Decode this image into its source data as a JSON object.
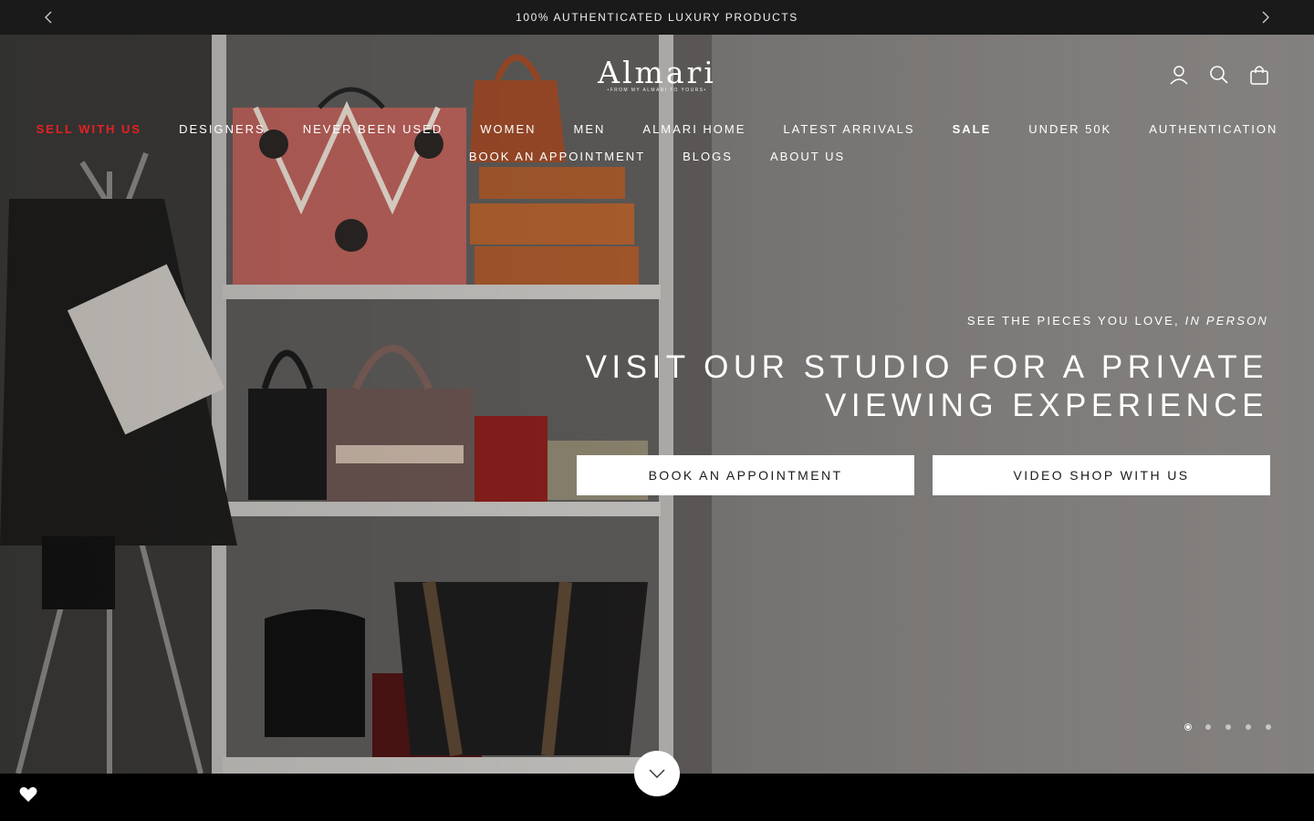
{
  "announcement": {
    "text": "100% AUTHENTICATED LUXURY PRODUCTS",
    "prev_icon": "chevron-left-icon",
    "next_icon": "chevron-right-icon"
  },
  "logo": {
    "name": "Almari",
    "tagline": "•FROM MY ALMARI TO YOURS•"
  },
  "header_icons": [
    "account-icon",
    "search-icon",
    "cart-icon"
  ],
  "nav": {
    "row1": [
      {
        "label": "SELL WITH US"
      },
      {
        "label": "DESIGNERS"
      },
      {
        "label": "NEVER BEEN USED"
      },
      {
        "label": "WOMEN"
      },
      {
        "label": "MEN"
      },
      {
        "label": "ALMARI HOME"
      },
      {
        "label": "LATEST ARRIVALS"
      },
      {
        "label": "SALE"
      },
      {
        "label": "UNDER 50K"
      },
      {
        "label": "AUTHENTICATION"
      }
    ],
    "row2": [
      {
        "label": "BOOK AN APPOINTMENT"
      },
      {
        "label": "BLOGS"
      },
      {
        "label": "ABOUT US"
      }
    ]
  },
  "hero": {
    "eyebrow_main": "SEE THE PIECES YOU LOVE,",
    "eyebrow_italic": "IN PERSON",
    "heading_line1": "VISIT OUR STUDIO FOR A PRIVATE",
    "heading_line2": "VIEWING EXPERIENCE",
    "cta_primary": "BOOK AN APPOINTMENT",
    "cta_secondary": "VIDEO SHOP WITH US",
    "slides_total": 5,
    "slide_active": 1
  },
  "colors": {
    "announcement_bg": "#1a1a1a",
    "accent_red": "#e52121",
    "cta_bg": "#ffffff"
  },
  "scroll_icon": "chevron-down-icon",
  "wishlist_icon": "heart-icon"
}
